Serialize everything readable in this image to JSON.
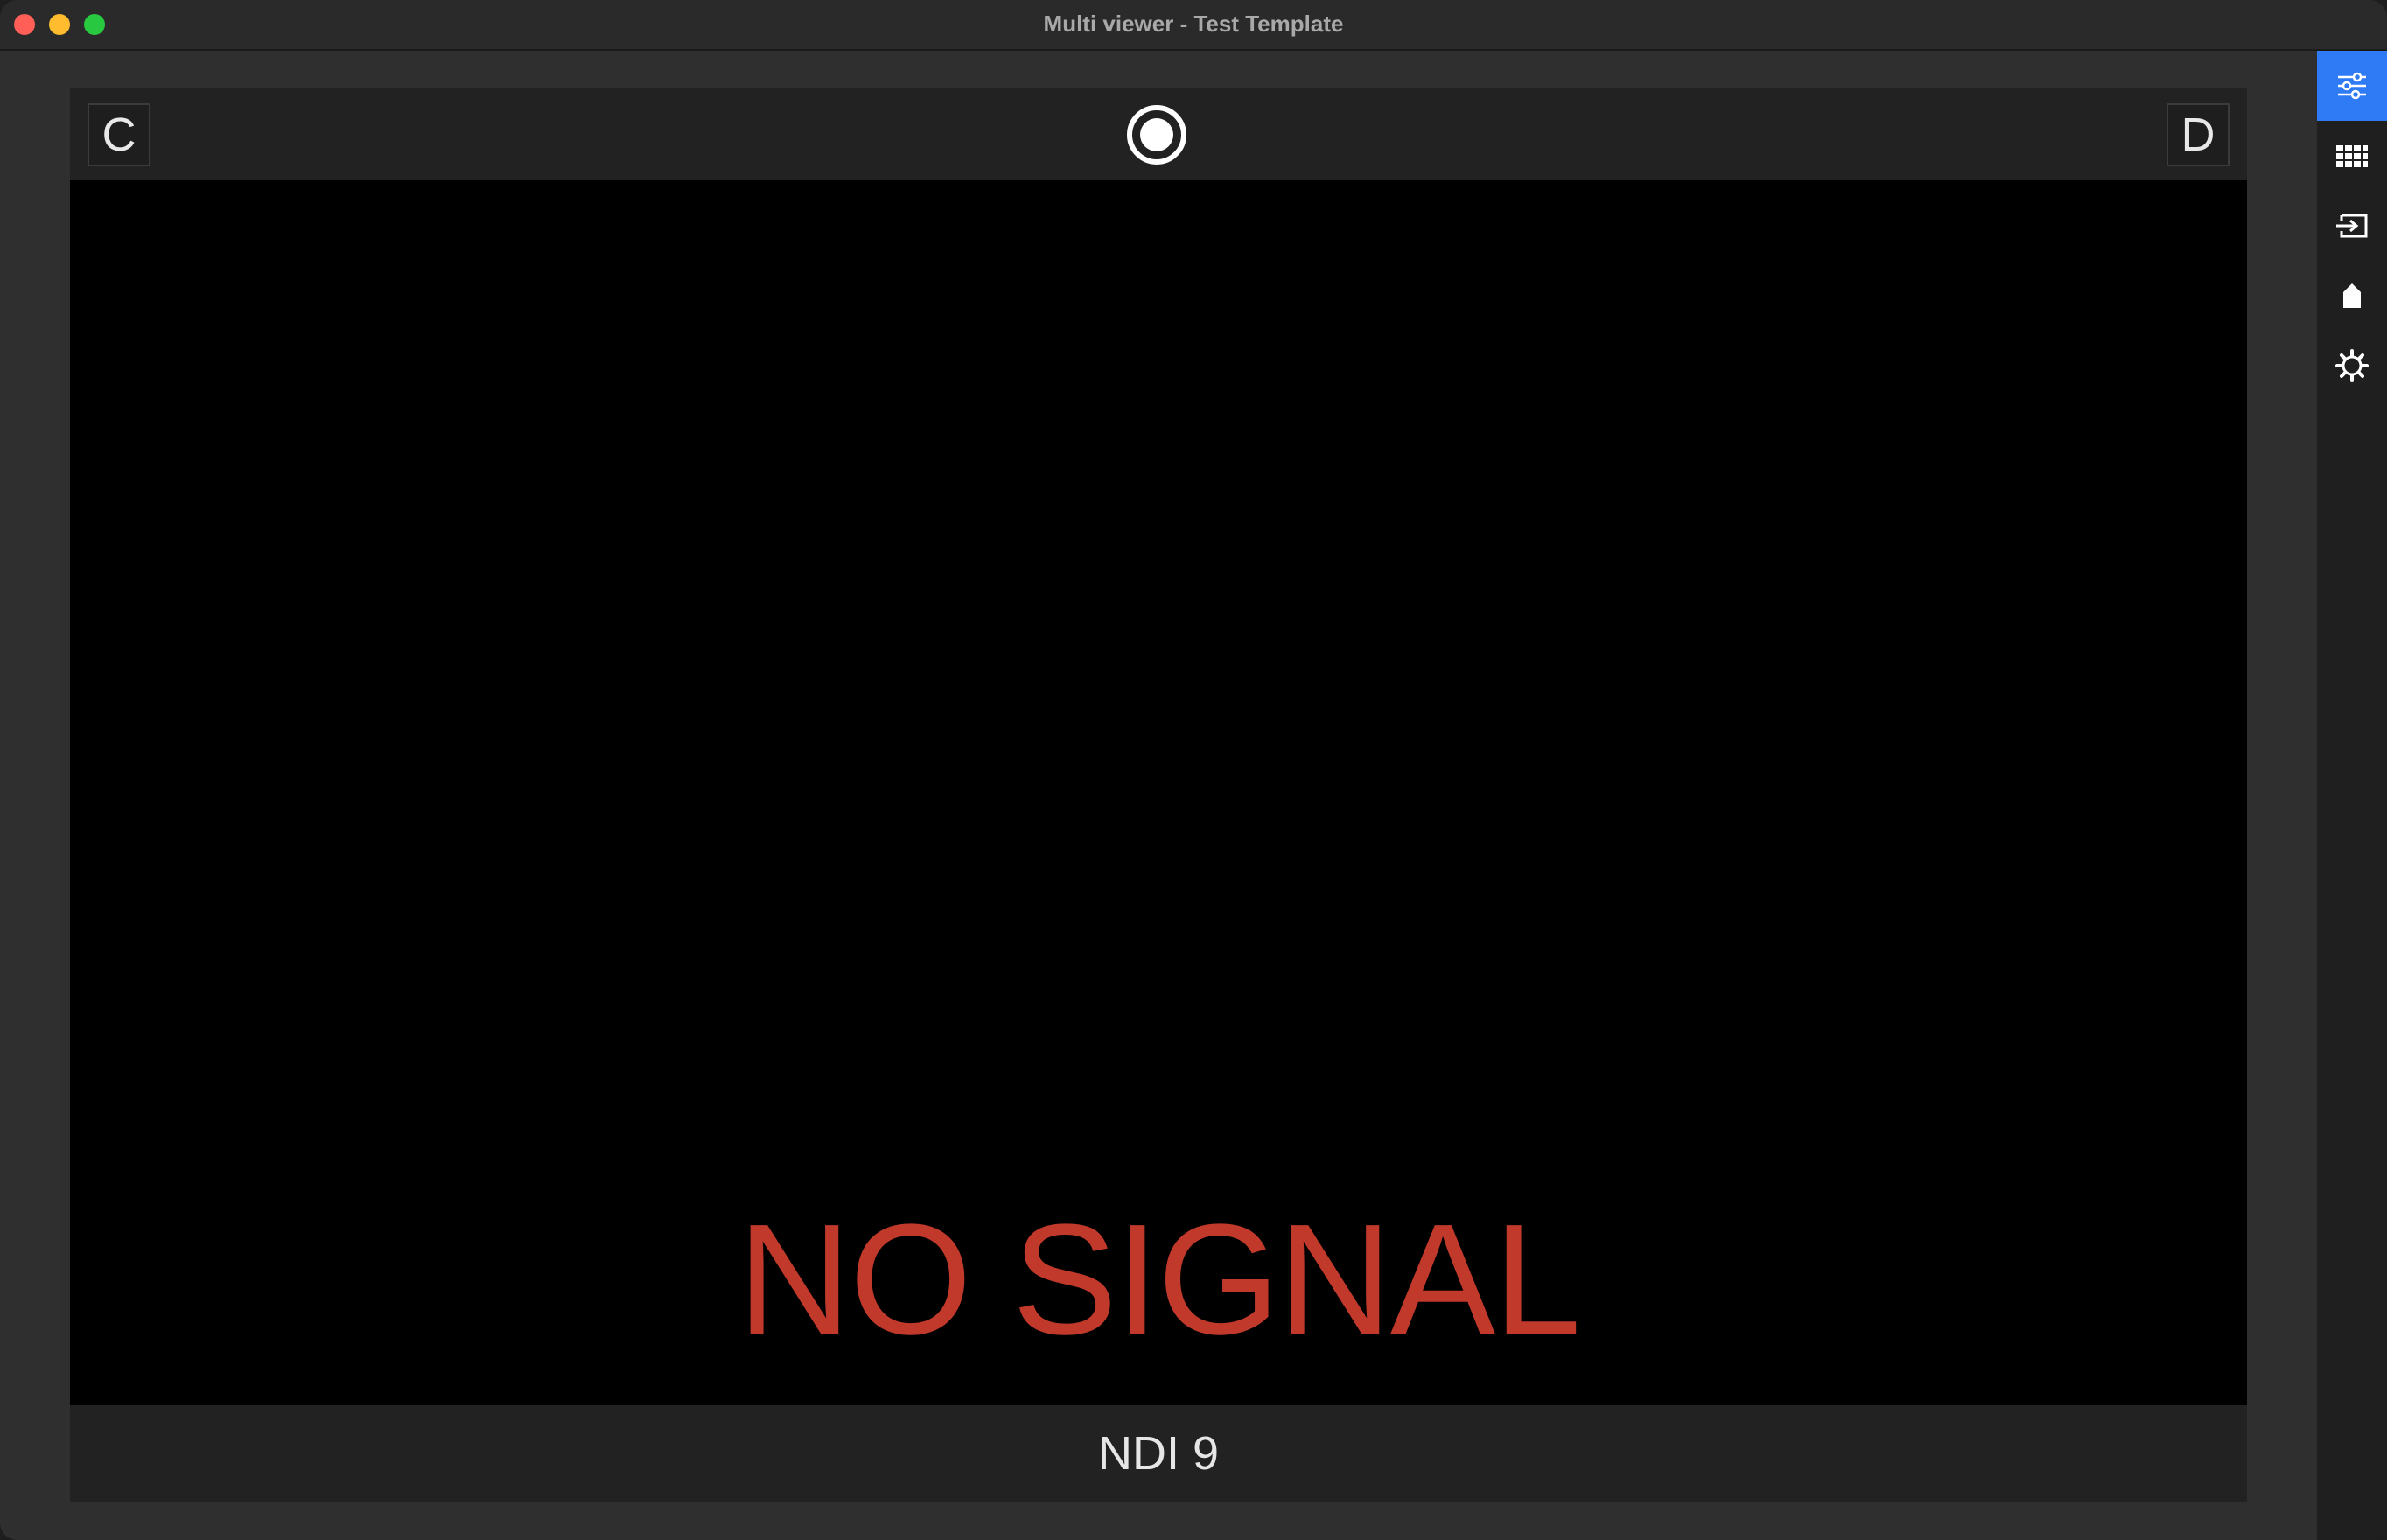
{
  "window": {
    "title": "Multi viewer - Test Template"
  },
  "viewer": {
    "left_label": "C",
    "right_label": "D",
    "status_text": "NO SIGNAL",
    "source_name": "NDI 9"
  },
  "sidebar": {
    "items": [
      {
        "icon": "sliders-icon",
        "active": true
      },
      {
        "icon": "grid-icon",
        "active": false
      },
      {
        "icon": "input-icon",
        "active": false
      },
      {
        "icon": "tag-icon",
        "active": false
      },
      {
        "icon": "gear-icon",
        "active": false
      }
    ]
  },
  "colors": {
    "accent": "#2f7bf5",
    "no_signal": "#c0392b"
  }
}
